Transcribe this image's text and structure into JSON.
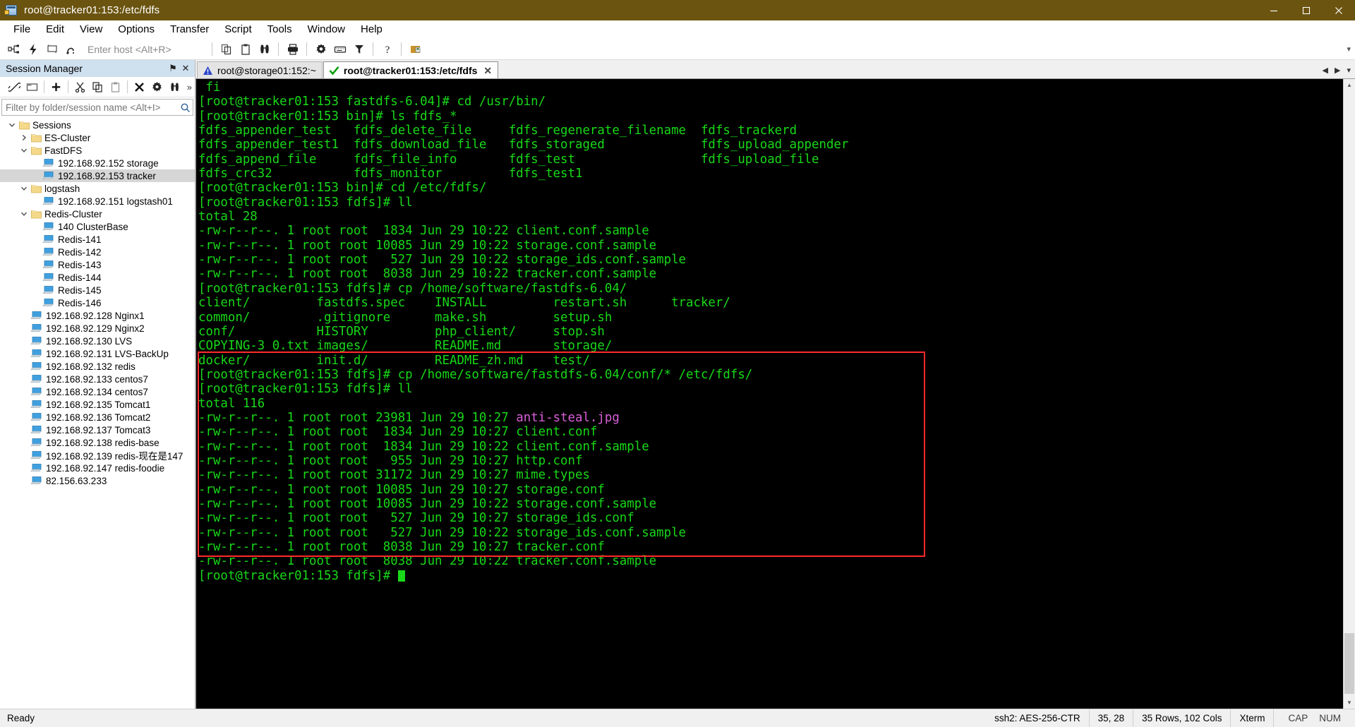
{
  "window": {
    "title": "root@tracker01:153:/etc/fdfs",
    "icon": "securecrt-icon",
    "minimize_label": "–",
    "maximize_label": "❐",
    "close_label": "✕"
  },
  "menubar": {
    "items": [
      {
        "label": "File",
        "name": "menu-file"
      },
      {
        "label": "Edit",
        "name": "menu-edit"
      },
      {
        "label": "View",
        "name": "menu-view"
      },
      {
        "label": "Options",
        "name": "menu-options"
      },
      {
        "label": "Transfer",
        "name": "menu-transfer"
      },
      {
        "label": "Script",
        "name": "menu-script"
      },
      {
        "label": "Tools",
        "name": "menu-tools"
      },
      {
        "label": "Window",
        "name": "menu-window"
      },
      {
        "label": "Help",
        "name": "menu-help"
      }
    ]
  },
  "toolbar": {
    "host_placeholder": "Enter host <Alt+R>",
    "buttons": [
      {
        "name": "new-session-icon",
        "title": "New Session"
      },
      {
        "name": "quick-connect-icon",
        "title": "Quick Connect"
      },
      {
        "name": "reconnect-icon",
        "title": "Reconnect"
      },
      {
        "name": "disconnect-icon",
        "title": "Disconnect"
      },
      {
        "name": "copy-icon",
        "title": "Copy"
      },
      {
        "name": "paste-icon",
        "title": "Paste"
      },
      {
        "name": "find-icon",
        "title": "Find"
      },
      {
        "name": "print-icon",
        "title": "Print"
      },
      {
        "name": "session-options-icon",
        "title": "Session Options"
      },
      {
        "name": "keymap-icon",
        "title": "Keymap Editor"
      },
      {
        "name": "filter-icon",
        "title": "Filter"
      },
      {
        "name": "help-icon",
        "title": "Help"
      },
      {
        "name": "securecrt-logo-icon",
        "title": "About"
      }
    ]
  },
  "session_manager": {
    "title": "Session Manager",
    "pin_label": "⚑",
    "close_label": "✕",
    "filter_placeholder": "Filter by folder/session name <Alt+I>",
    "search_icon": "search-icon",
    "toolbar_buttons": [
      {
        "name": "connect-icon",
        "title": "Connect"
      },
      {
        "name": "connect-in-tab-icon",
        "title": "Connect in Tab"
      },
      {
        "name": "new-session-icon",
        "title": "New Session"
      },
      {
        "name": "cut-icon",
        "title": "Cut"
      },
      {
        "name": "copy-icon",
        "title": "Copy"
      },
      {
        "name": "paste-icon",
        "title": "Paste"
      },
      {
        "name": "delete-icon",
        "title": "Delete"
      },
      {
        "name": "properties-icon",
        "title": "Properties"
      },
      {
        "name": "find-icon",
        "title": "Find"
      }
    ],
    "overflow_label": "»",
    "tree": [
      {
        "label": "Sessions",
        "type": "folder",
        "depth": 0,
        "expanded": true,
        "selected": false
      },
      {
        "label": "ES-Cluster",
        "type": "folder",
        "depth": 1,
        "expanded": false,
        "selected": false
      },
      {
        "label": "FastDFS",
        "type": "folder",
        "depth": 1,
        "expanded": true,
        "selected": false
      },
      {
        "label": "192.168.92.152 storage",
        "type": "session",
        "depth": 2,
        "selected": false
      },
      {
        "label": "192.168.92.153 tracker",
        "type": "session",
        "depth": 2,
        "selected": true
      },
      {
        "label": "logstash",
        "type": "folder",
        "depth": 1,
        "expanded": true,
        "selected": false
      },
      {
        "label": "192.168.92.151 logstash01",
        "type": "session",
        "depth": 2,
        "selected": false
      },
      {
        "label": "Redis-Cluster",
        "type": "folder",
        "depth": 1,
        "expanded": true,
        "selected": false
      },
      {
        "label": "140 ClusterBase",
        "type": "session",
        "depth": 2,
        "selected": false
      },
      {
        "label": "Redis-141",
        "type": "session",
        "depth": 2,
        "selected": false
      },
      {
        "label": "Redis-142",
        "type": "session",
        "depth": 2,
        "selected": false
      },
      {
        "label": "Redis-143",
        "type": "session",
        "depth": 2,
        "selected": false
      },
      {
        "label": "Redis-144",
        "type": "session",
        "depth": 2,
        "selected": false
      },
      {
        "label": "Redis-145",
        "type": "session",
        "depth": 2,
        "selected": false
      },
      {
        "label": "Redis-146",
        "type": "session",
        "depth": 2,
        "selected": false
      },
      {
        "label": "192.168.92.128  Nginx1",
        "type": "session",
        "depth": 1,
        "selected": false
      },
      {
        "label": "192.168.92.129  Nginx2",
        "type": "session",
        "depth": 1,
        "selected": false
      },
      {
        "label": "192.168.92.130  LVS",
        "type": "session",
        "depth": 1,
        "selected": false
      },
      {
        "label": "192.168.92.131  LVS-BackUp",
        "type": "session",
        "depth": 1,
        "selected": false
      },
      {
        "label": "192.168.92.132  redis",
        "type": "session",
        "depth": 1,
        "selected": false
      },
      {
        "label": "192.168.92.133  centos7",
        "type": "session",
        "depth": 1,
        "selected": false
      },
      {
        "label": "192.168.92.134  centos7",
        "type": "session",
        "depth": 1,
        "selected": false
      },
      {
        "label": "192.168.92.135  Tomcat1",
        "type": "session",
        "depth": 1,
        "selected": false
      },
      {
        "label": "192.168.92.136  Tomcat2",
        "type": "session",
        "depth": 1,
        "selected": false
      },
      {
        "label": "192.168.92.137  Tomcat3",
        "type": "session",
        "depth": 1,
        "selected": false
      },
      {
        "label": "192.168.92.138 redis-base",
        "type": "session",
        "depth": 1,
        "selected": false
      },
      {
        "label": "192.168.92.139 redis-现在是147",
        "type": "session",
        "depth": 1,
        "selected": false
      },
      {
        "label": "192.168.92.147 redis-foodie",
        "type": "session",
        "depth": 1,
        "selected": false
      },
      {
        "label": "82.156.63.233",
        "type": "session",
        "depth": 1,
        "selected": false
      }
    ]
  },
  "tabs": {
    "items": [
      {
        "label": "root@storage01:152:~",
        "icon": "warning-icon",
        "active": false,
        "closable": false
      },
      {
        "label": "root@tracker01:153:/etc/fdfs",
        "icon": "connected-check-icon",
        "active": true,
        "closable": true,
        "close_label": "✕"
      }
    ],
    "nav_prev": "◀",
    "nav_next": "▶",
    "nav_menu": "▾"
  },
  "terminal": {
    "colors": {
      "background": "#000000",
      "foreground": "#18d818",
      "image_file": "#d95fd9",
      "directory": "#4d72e6",
      "highlight_box": "#ff2a2a"
    },
    "lines": [
      {
        "text": " fi",
        "color": "green"
      },
      {
        "text": "[root@tracker01:153 fastdfs-6.04]# cd /usr/bin/",
        "color": "green"
      },
      {
        "text": "[root@tracker01:153 bin]# ls fdfs_*",
        "color": "green"
      },
      {
        "text": "fdfs_appender_test   fdfs_delete_file     fdfs_regenerate_filename  fdfs_trackerd",
        "color": "green"
      },
      {
        "text": "fdfs_appender_test1  fdfs_download_file   fdfs_storaged             fdfs_upload_appender",
        "color": "green"
      },
      {
        "text": "fdfs_append_file     fdfs_file_info       fdfs_test                 fdfs_upload_file",
        "color": "green"
      },
      {
        "text": "fdfs_crc32           fdfs_monitor         fdfs_test1",
        "color": "green"
      },
      {
        "text": "[root@tracker01:153 bin]# cd /etc/fdfs/",
        "color": "green"
      },
      {
        "text": "[root@tracker01:153 fdfs]# ll",
        "color": "green"
      },
      {
        "text": "total 28",
        "color": "green"
      },
      {
        "text": "-rw-r--r--. 1 root root  1834 Jun 29 10:22 client.conf.sample",
        "color": "green"
      },
      {
        "text": "-rw-r--r--. 1 root root 10085 Jun 29 10:22 storage.conf.sample",
        "color": "green"
      },
      {
        "text": "-rw-r--r--. 1 root root   527 Jun 29 10:22 storage_ids.conf.sample",
        "color": "green"
      },
      {
        "text": "-rw-r--r--. 1 root root  8038 Jun 29 10:22 tracker.conf.sample",
        "color": "green"
      },
      {
        "text": "[root@tracker01:153 fdfs]# cp /home/software/fastdfs-6.04/",
        "color": "green"
      },
      {
        "text": "client/         fastdfs.spec    INSTALL         restart.sh      tracker/",
        "color": "green"
      },
      {
        "text": "common/         .gitignore      make.sh         setup.sh",
        "color": "green"
      },
      {
        "text": "conf/           HISTORY         php_client/     stop.sh",
        "color": "green"
      },
      {
        "text": "COPYING-3_0.txt images/         README.md       storage/",
        "color": "green"
      },
      {
        "text": "docker/         init.d/         README_zh.md    test/",
        "color": "green"
      },
      {
        "text": "[root@tracker01:153 fdfs]# cp /home/software/fastdfs-6.04/conf/* /etc/fdfs/",
        "color": "green"
      },
      {
        "text": "[root@tracker01:153 fdfs]# ll",
        "color": "green"
      },
      {
        "text": "total 116",
        "color": "green"
      },
      {
        "text": "-rw-r--r--. 1 root root 23981 Jun 29 10:27 ",
        "color": "green",
        "suffix": "anti-steal.jpg",
        "suffix_color": "magenta"
      },
      {
        "text": "-rw-r--r--. 1 root root  1834 Jun 29 10:27 client.conf",
        "color": "green"
      },
      {
        "text": "-rw-r--r--. 1 root root  1834 Jun 29 10:22 client.conf.sample",
        "color": "green"
      },
      {
        "text": "-rw-r--r--. 1 root root   955 Jun 29 10:27 http.conf",
        "color": "green"
      },
      {
        "text": "-rw-r--r--. 1 root root 31172 Jun 29 10:27 mime.types",
        "color": "green"
      },
      {
        "text": "-rw-r--r--. 1 root root 10085 Jun 29 10:27 storage.conf",
        "color": "green"
      },
      {
        "text": "-rw-r--r--. 1 root root 10085 Jun 29 10:22 storage.conf.sample",
        "color": "green"
      },
      {
        "text": "-rw-r--r--. 1 root root   527 Jun 29 10:27 storage_ids.conf",
        "color": "green"
      },
      {
        "text": "-rw-r--r--. 1 root root   527 Jun 29 10:22 storage_ids.conf.sample",
        "color": "green"
      },
      {
        "text": "-rw-r--r--. 1 root root  8038 Jun 29 10:27 tracker.conf",
        "color": "green"
      },
      {
        "text": "-rw-r--r--. 1 root root  8038 Jun 29 10:22 tracker.conf.sample",
        "color": "green"
      },
      {
        "text": "[root@tracker01:153 fdfs]# ",
        "color": "green",
        "cursor": true
      }
    ]
  },
  "statusbar": {
    "ready": "Ready",
    "encryption": "ssh2: AES-256-CTR",
    "cursor_position": "35, 28",
    "dimensions": "35 Rows, 102 Cols",
    "emulation": "Xterm",
    "caps": "CAP",
    "num": "NUM"
  }
}
